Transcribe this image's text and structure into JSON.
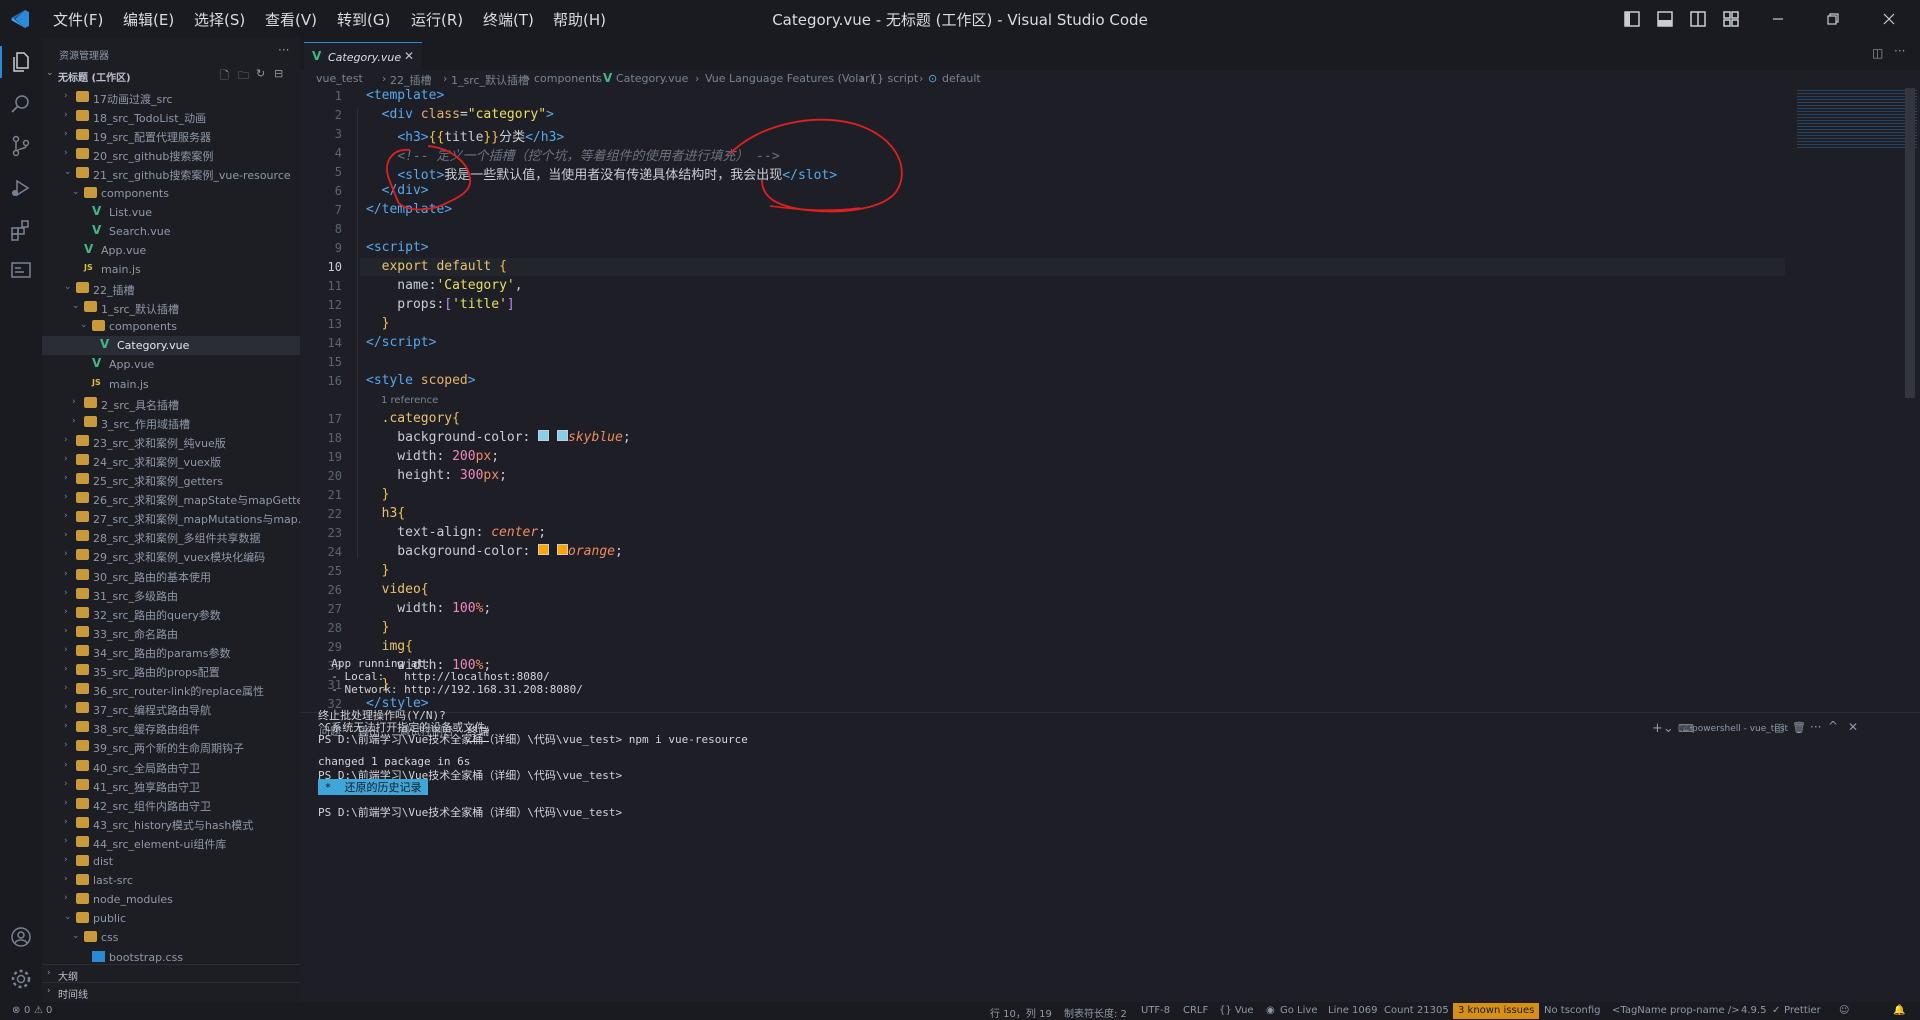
{
  "titlebar": {
    "menus": [
      "文件(F)",
      "编辑(E)",
      "选择(S)",
      "查看(V)",
      "转到(G)",
      "运行(R)",
      "终端(T)",
      "帮助(H)"
    ],
    "title": "Category.vue - 无标题 (工作区) - Visual Studio Code"
  },
  "sidebar": {
    "header": "资源管理器",
    "workspace": "无标题 (工作区)",
    "items": [
      {
        "label": "17动画过渡_src",
        "type": "folder",
        "depth": 1
      },
      {
        "label": "18_src_TodoList_动画",
        "type": "folder",
        "depth": 1
      },
      {
        "label": "19_src_配置代理服务器",
        "type": "folder",
        "depth": 1
      },
      {
        "label": "20_src_github搜索案例",
        "type": "folder",
        "depth": 1
      },
      {
        "label": "21_src_github搜索案例_vue-resource",
        "type": "folder-open",
        "depth": 1
      },
      {
        "label": "components",
        "type": "folder-open",
        "depth": 2
      },
      {
        "label": "List.vue",
        "type": "vue",
        "depth": 3
      },
      {
        "label": "Search.vue",
        "type": "vue",
        "depth": 3
      },
      {
        "label": "App.vue",
        "type": "vue",
        "depth": 2
      },
      {
        "label": "main.js",
        "type": "js",
        "depth": 2
      },
      {
        "label": "22_插槽",
        "type": "folder-open",
        "depth": 1
      },
      {
        "label": "1_src_默认插槽",
        "type": "folder-open",
        "depth": 2
      },
      {
        "label": "components",
        "type": "folder-open",
        "depth": 3
      },
      {
        "label": "Category.vue",
        "type": "vue",
        "depth": 4,
        "selected": true
      },
      {
        "label": "App.vue",
        "type": "vue",
        "depth": 3
      },
      {
        "label": "main.js",
        "type": "js",
        "depth": 3
      },
      {
        "label": "2_src_具名插槽",
        "type": "folder",
        "depth": 2
      },
      {
        "label": "3_src_作用域插槽",
        "type": "folder",
        "depth": 2
      },
      {
        "label": "23_src_求和案例_纯vue版",
        "type": "folder",
        "depth": 1
      },
      {
        "label": "24_src_求和案例_vuex版",
        "type": "folder",
        "depth": 1
      },
      {
        "label": "25_src_求和案例_getters",
        "type": "folder",
        "depth": 1
      },
      {
        "label": "26_src_求和案例_mapState与mapGetters",
        "type": "folder",
        "depth": 1
      },
      {
        "label": "27_src_求和案例_mapMutations与map...",
        "type": "folder",
        "depth": 1
      },
      {
        "label": "28_src_求和案例_多组件共享数据",
        "type": "folder",
        "depth": 1
      },
      {
        "label": "29_src_求和案例_vuex模块化编码",
        "type": "folder",
        "depth": 1
      },
      {
        "label": "30_src_路由的基本使用",
        "type": "folder",
        "depth": 1
      },
      {
        "label": "31_src_多级路由",
        "type": "folder",
        "depth": 1
      },
      {
        "label": "32_src_路由的query参数",
        "type": "folder",
        "depth": 1
      },
      {
        "label": "33_src_命名路由",
        "type": "folder",
        "depth": 1
      },
      {
        "label": "34_src_路由的params参数",
        "type": "folder",
        "depth": 1
      },
      {
        "label": "35_src_路由的props配置",
        "type": "folder",
        "depth": 1
      },
      {
        "label": "36_src_router-link的replace属性",
        "type": "folder",
        "depth": 1
      },
      {
        "label": "37_src_编程式路由导航",
        "type": "folder",
        "depth": 1
      },
      {
        "label": "38_src_缓存路由组件",
        "type": "folder",
        "depth": 1
      },
      {
        "label": "39_src_两个新的生命周期钩子",
        "type": "folder",
        "depth": 1
      },
      {
        "label": "40_src_全局路由守卫",
        "type": "folder",
        "depth": 1
      },
      {
        "label": "41_src_独享路由守卫",
        "type": "folder",
        "depth": 1
      },
      {
        "label": "42_src_组件内路由守卫",
        "type": "folder",
        "depth": 1
      },
      {
        "label": "43_src_history模式与hash模式",
        "type": "folder",
        "depth": 1
      },
      {
        "label": "44_src_element-ui组件库",
        "type": "folder",
        "depth": 1
      },
      {
        "label": "dist",
        "type": "folder",
        "depth": 1
      },
      {
        "label": "last-src",
        "type": "folder",
        "depth": 1
      },
      {
        "label": "node_modules",
        "type": "folder",
        "depth": 1
      },
      {
        "label": "public",
        "type": "folder-open",
        "depth": 1
      },
      {
        "label": "css",
        "type": "folder-open",
        "depth": 2
      },
      {
        "label": "bootstrap.css",
        "type": "css",
        "depth": 3
      }
    ],
    "outline": "大纲",
    "timeline": "时间线"
  },
  "editor": {
    "tab_label": "Category.vue",
    "breadcrumbs": [
      "vue_test",
      "22_插槽",
      "1_src_默认插槽",
      "components",
      "Category.vue",
      "Vue Language Features (Volar)",
      "{} script",
      "default"
    ],
    "codelens": "1 reference",
    "line_numbers": [
      "1",
      "2",
      "3",
      "4",
      "5",
      "6",
      "7",
      "8",
      "9",
      "10",
      "11",
      "12",
      "13",
      "14",
      "15",
      "16",
      "17",
      "18",
      "19",
      "20",
      "21",
      "22",
      "23",
      "24",
      "25",
      "26",
      "27",
      "28",
      "29",
      "30",
      "31",
      "32"
    ]
  },
  "panel": {
    "tabs": [
      "问题",
      "输出",
      "调试控制台",
      "终端"
    ],
    "terminal_name": "powershell - vue_test",
    "lines": [
      "  App running at:",
      "  - Local:   http://localhost:8080/",
      "  - Network: http://192.168.31.208:8080/",
      "",
      "终止批处理操作吗(Y/N)?",
      "^C系统无法打开指定的设备或文件。",
      "PS D:\\前端学习\\Vue技术全家桶（详细）\\代码\\vue_test> npm i vue-resource",
      "",
      "changed 1 package in 6s",
      "PS D:\\前端学习\\Vue技术全家桶（详细）\\代码\\vue_test>",
      " *  还原的历史记录 ",
      "",
      "PS D:\\前端学习\\Vue技术全家桶（详细）\\代码\\vue_test>"
    ]
  },
  "statusbar": {
    "errors": "0",
    "warnings": "0",
    "cursor": "行 10，列 19",
    "indent": "制表符长度: 2",
    "encoding": "UTF-8",
    "eol": "CRLF",
    "language": "{} Vue",
    "golive": "Go Live",
    "line": "Line 1069",
    "count": "Count 21305",
    "issues": "3 known issues",
    "tsconfig": "No tsconfig",
    "tagname": "<TagName prop-name />",
    "version": "4.9.5",
    "prettier": "Prettier"
  }
}
